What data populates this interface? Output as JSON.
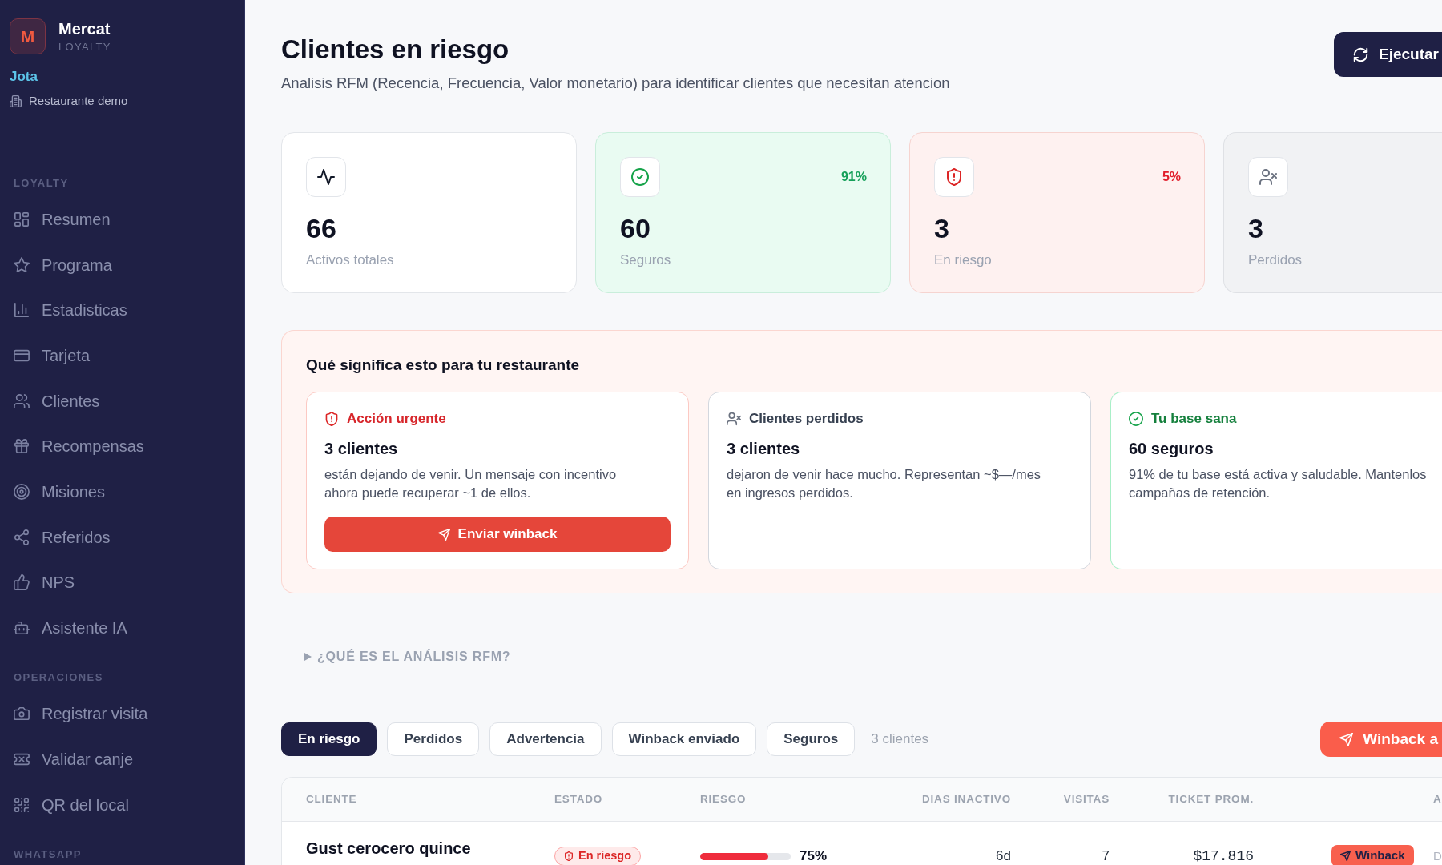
{
  "sidebar": {
    "brand": {
      "logo_letter": "M",
      "name": "Mercat",
      "tagline": "LOYALTY"
    },
    "user": "Jota",
    "venue": "Restaurante demo",
    "sections": [
      {
        "title": "LOYALTY",
        "items": [
          "Resumen",
          "Programa",
          "Estadisticas",
          "Tarjeta",
          "Clientes",
          "Recompensas",
          "Misiones",
          "Referidos",
          "NPS",
          "Asistente IA"
        ]
      },
      {
        "title": "OPERACIONES",
        "items": [
          "Registrar visita",
          "Validar canje",
          "QR del local"
        ]
      },
      {
        "title": "WHATSAPP"
      }
    ]
  },
  "header": {
    "title": "Clientes en riesgo",
    "subtitle": "Analisis RFM (Recencia, Frecuencia, Valor monetario) para identificar clientes que necesitan atencion",
    "action_button": "Ejecutar"
  },
  "stats": [
    {
      "kind": "total",
      "value": "66",
      "label": "Activos totales"
    },
    {
      "kind": "safe",
      "value": "60",
      "label": "Seguros",
      "percent": "91%"
    },
    {
      "kind": "risk",
      "value": "3",
      "label": "En riesgo",
      "percent": "5%"
    },
    {
      "kind": "lost",
      "value": "3",
      "label": "Perdidos"
    }
  ],
  "insights": {
    "title": "Qué significa esto para tu restaurante",
    "cards": [
      {
        "kind": "urgent",
        "heading": "Acción urgente",
        "count": "3 clientes",
        "lines": [
          "están dejando de venir. Un mensaje con incentivo",
          "ahora puede recuperar ~1 de ellos."
        ],
        "button": "Enviar winback"
      },
      {
        "kind": "lost",
        "heading": "Clientes perdidos",
        "count": "3 clientes",
        "lines": [
          "dejaron de venir hace mucho. Representan ~$—/mes",
          "en ingresos perdidos."
        ]
      },
      {
        "kind": "healthy",
        "heading": "Tu base sana",
        "count": "60 seguros",
        "lines": [
          "91% de tu base está activa y saludable. Mantenlos",
          "campañas de retención."
        ]
      }
    ]
  },
  "rfm_toggle": {
    "label": "¿QUÉ ES EL ANÁLISIS RFM?",
    "expanded": false
  },
  "filters": {
    "tabs": [
      {
        "label": "En riesgo",
        "selected": true
      },
      {
        "label": "Perdidos",
        "selected": false
      },
      {
        "label": "Advertencia",
        "selected": false
      },
      {
        "label": "Winback enviado",
        "selected": false
      },
      {
        "label": "Seguros",
        "selected": false
      }
    ],
    "count": "3 clientes",
    "bulk_button": "Winback a"
  },
  "table": {
    "columns": [
      "CLIENTE",
      "ESTADO",
      "RIESGO",
      "DIAS INACTIVO",
      "VISITAS",
      "TICKET PROM.",
      "A"
    ],
    "rows": [
      {
        "client": "Gust cerocero quince",
        "status": {
          "kind": "risk",
          "label": "En riesgo"
        },
        "risk": {
          "level": 0.75,
          "reading": "75%"
        },
        "days_inactive": "6d",
        "visits": "7",
        "ticket": "$17.816",
        "actions": {
          "button": "Winback",
          "link": "D"
        }
      }
    ]
  }
}
